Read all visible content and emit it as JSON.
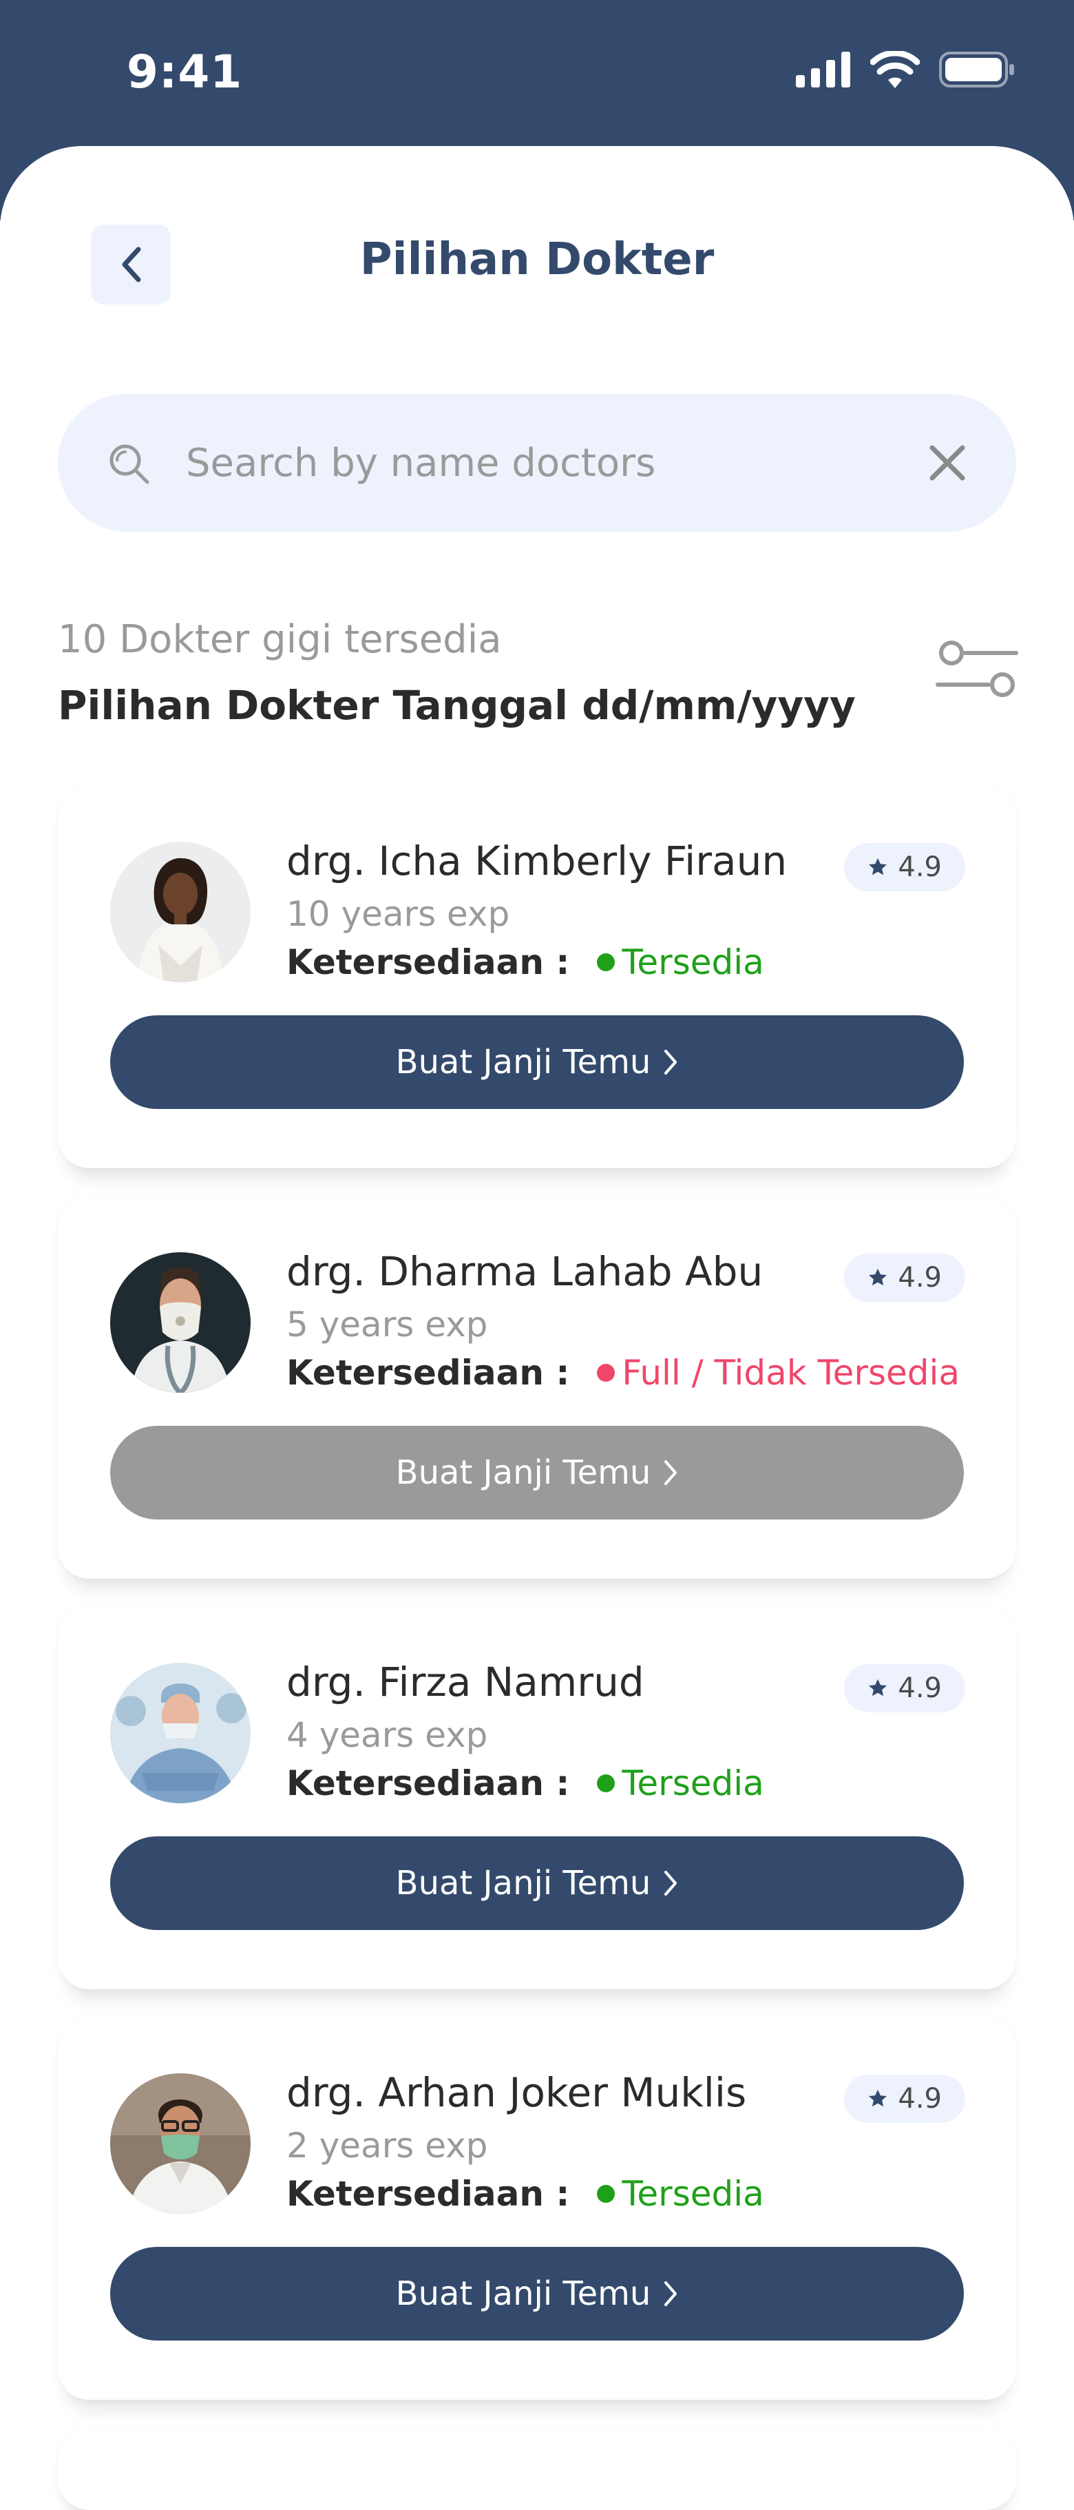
{
  "status_bar": {
    "time": "9:41"
  },
  "header": {
    "title": "Pilihan Dokter",
    "back_icon": "chevron-left-icon"
  },
  "search": {
    "placeholder": "Search by name doctors",
    "value": "",
    "icon": "search-icon",
    "clear_icon": "close-icon"
  },
  "summary": {
    "count_text": "10 Dokter gigi tersedia",
    "date_text": "Pilihan Dokter Tanggal dd/mm/yyyy",
    "filter_icon": "filter-sliders-icon"
  },
  "colors": {
    "primary": "#344A6C",
    "disabled": "#9A9A9A",
    "available": "#1EA019",
    "unavailable": "#F0466B",
    "chip_bg": "#EEF2FC"
  },
  "doctors": [
    {
      "name": "drg. Icha Kimberly Firaun",
      "experience": "10 years exp",
      "availability_label": "Ketersediaan :",
      "availability_status": "Tersedia",
      "available": true,
      "rating": "4.9",
      "button_label": "Buat Janji Temu",
      "button_icon": "chevron-right-icon"
    },
    {
      "name": "drg. Dharma Lahab Abu",
      "experience": "5 years exp",
      "availability_label": "Ketersediaan :",
      "availability_status": "Full / Tidak Tersedia",
      "available": false,
      "rating": "4.9",
      "button_label": "Buat Janji Temu",
      "button_icon": "chevron-right-icon"
    },
    {
      "name": "drg. Firza Namrud",
      "experience": "4 years exp",
      "availability_label": "Ketersediaan :",
      "availability_status": "Tersedia",
      "available": true,
      "rating": "4.9",
      "button_label": "Buat Janji Temu",
      "button_icon": "chevron-right-icon"
    },
    {
      "name": "drg. Arhan Joker Muklis",
      "experience": "2 years exp",
      "availability_label": "Ketersediaan :",
      "availability_status": "Tersedia",
      "available": true,
      "rating": "4.9",
      "button_label": "Buat Janji Temu",
      "button_icon": "chevron-right-icon"
    }
  ]
}
